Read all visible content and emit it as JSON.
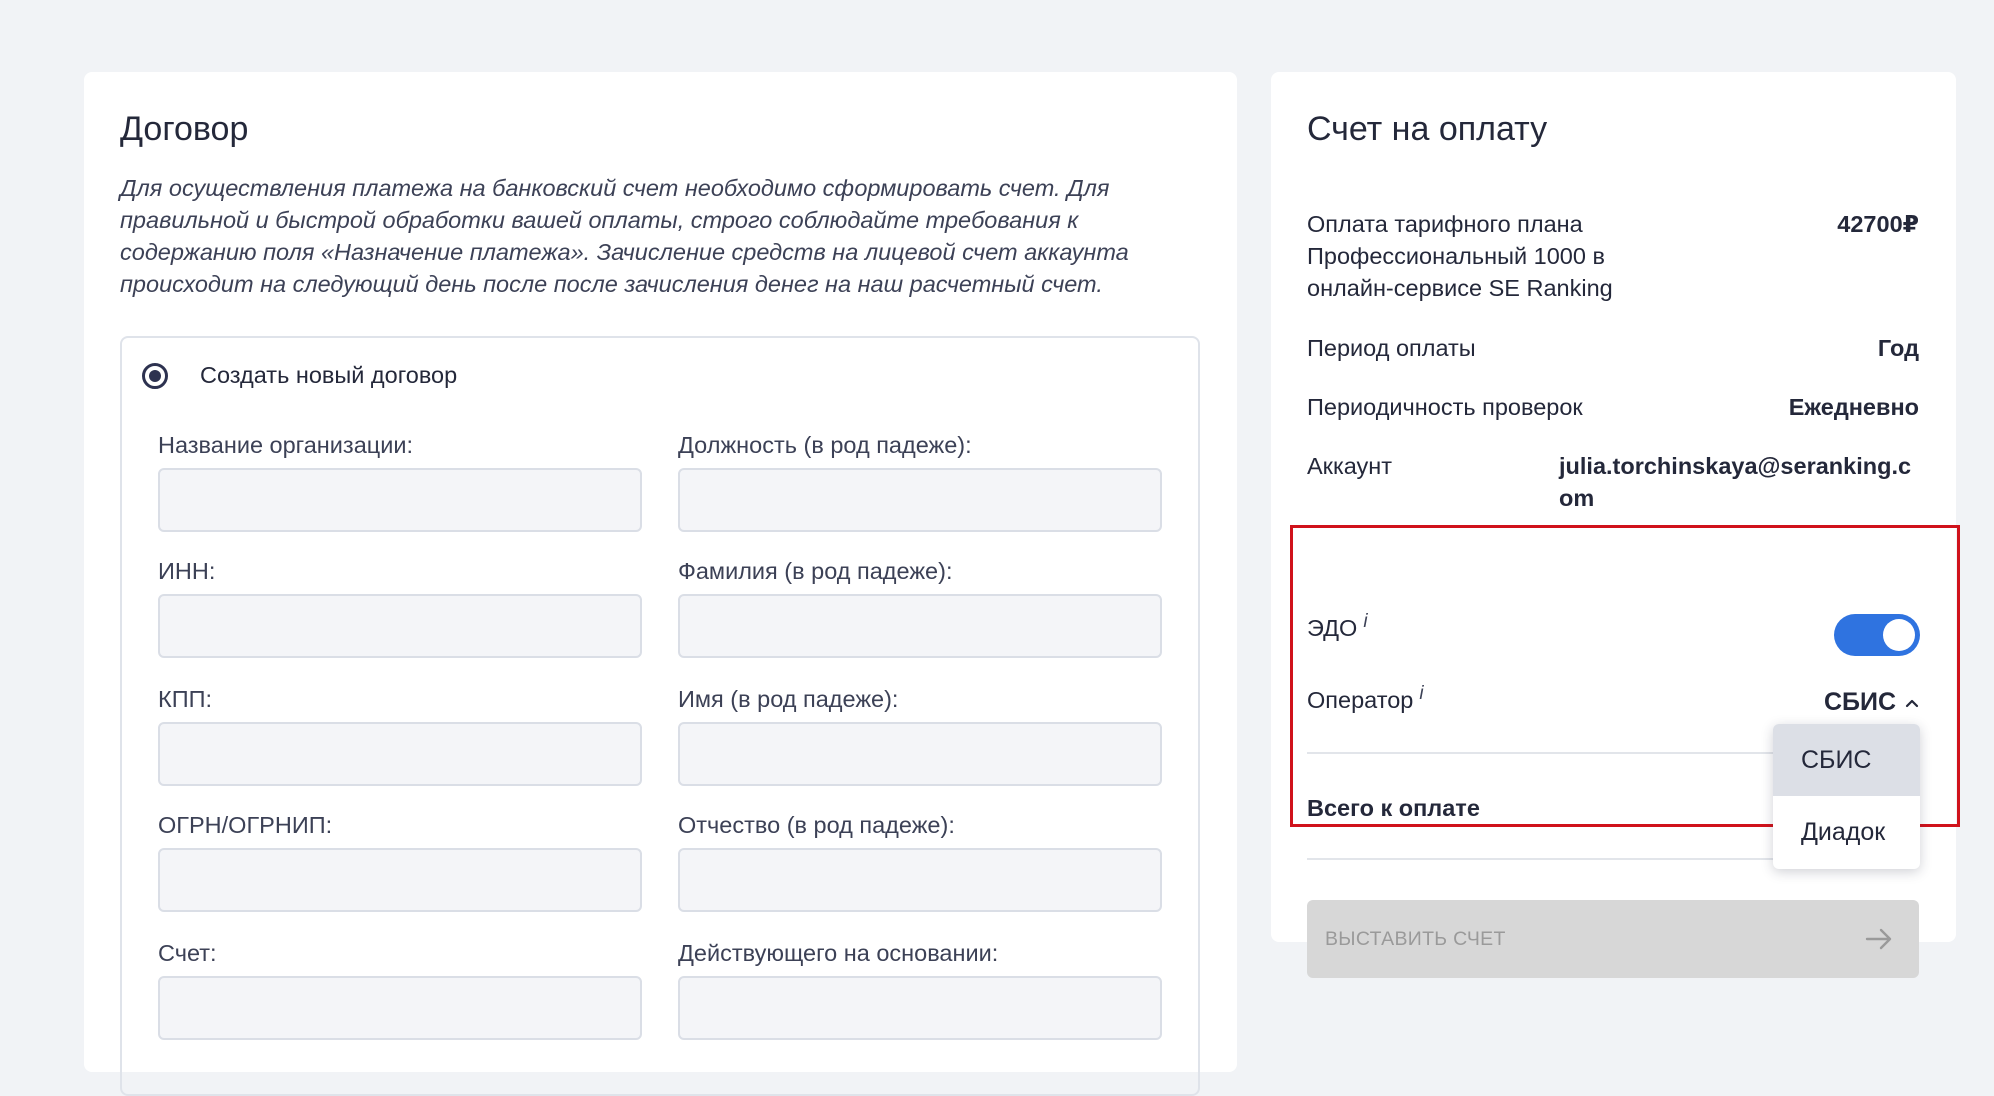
{
  "contract": {
    "title": "Договор",
    "description": "Для осуществления платежа на банковский счет необходимо сформировать счет. Для правильной и быстрой обработки вашей оплаты, строго соблюдайте требования к содержанию поля «Назначение платежа». Зачисление средств на лицевой счет аккаунта происходит на следующий день после после зачисления денег на наш расчетный счет.",
    "option_label": "Создать новый договор",
    "option_selected": true,
    "fields": [
      {
        "label": "Название организации:",
        "value": "",
        "placeholder": ""
      },
      {
        "label": "Должность (в род падеже):",
        "value": "",
        "placeholder": ""
      },
      {
        "label": "ИНН:",
        "value": "",
        "placeholder": ""
      },
      {
        "label": "Фамилия (в род падеже):",
        "value": "",
        "placeholder": ""
      },
      {
        "label": "КПП:",
        "value": "",
        "placeholder": ""
      },
      {
        "label": "Имя (в род падеже):",
        "value": "",
        "placeholder": ""
      },
      {
        "label": "ОГРН/ОГРНИП:",
        "value": "",
        "placeholder": ""
      },
      {
        "label": "Отчество (в род падеже):",
        "value": "",
        "placeholder": ""
      },
      {
        "label": "Счет:",
        "value": "",
        "placeholder": ""
      },
      {
        "label": "Действующего на основании:",
        "value": "",
        "placeholder": ""
      }
    ]
  },
  "invoice": {
    "title": "Счет на оплату",
    "plan_label": "Оплата тарифного плана Профессиональный 1000 в онлайн-сервисе SE Ranking",
    "plan_price": "42700₽",
    "period_label": "Период оплаты",
    "period_value": "Год",
    "frequency_label": "Периодичность проверок",
    "frequency_value": "Ежедневно",
    "account_label": "Аккаунт",
    "account_value": "julia.torchinskaya@seranking.com",
    "edo_label": "ЭДО",
    "edo_info": "i",
    "edo_enabled": true,
    "operator_label": "Оператор",
    "operator_info": "i",
    "operator_value": "СБИС",
    "operator_options": [
      "СБИС",
      "Диадок"
    ],
    "total_label": "Всего к оплате",
    "submit_label": "ВЫСТАВИТЬ СЧЕТ"
  },
  "colors": {
    "page_background": "#f1f3f6",
    "toggle_on": "#2f73e0",
    "highlight_border": "#d0121b",
    "button_disabled": "#d7d7d7"
  },
  "icons": [
    "radio-checked-icon",
    "info-icon",
    "toggle-switch",
    "chevron-up-icon",
    "arrow-right-icon"
  ]
}
